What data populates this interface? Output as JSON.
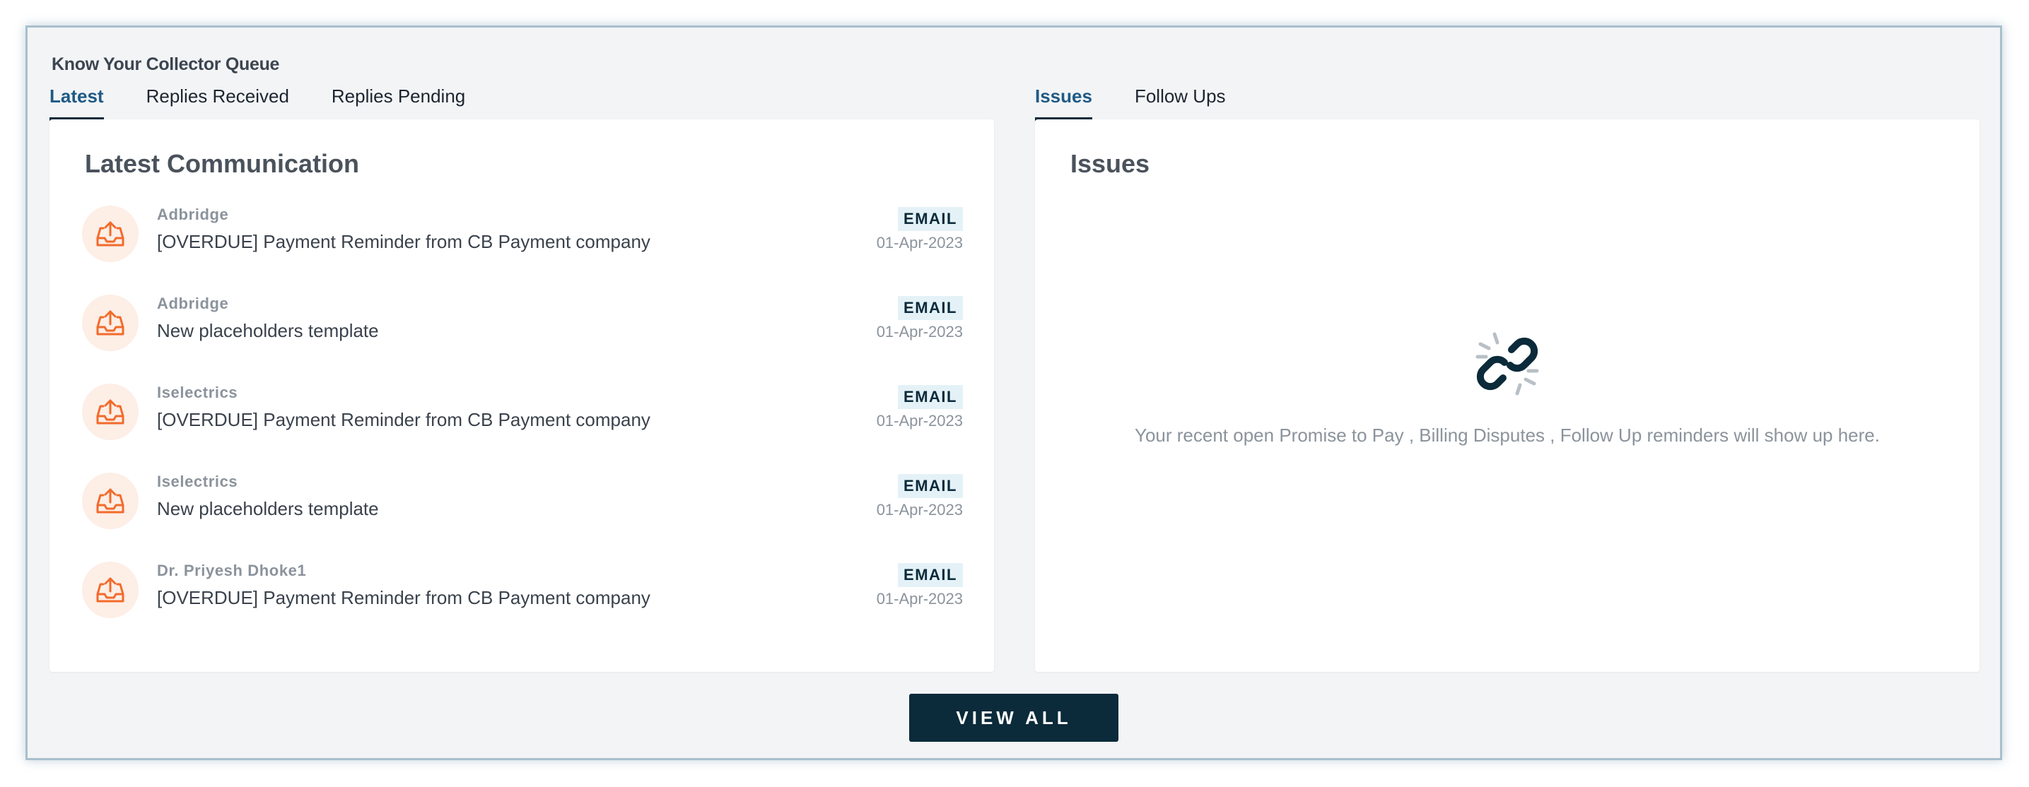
{
  "queue": {
    "title": "Know Your Collector Queue"
  },
  "left_tabs": [
    "Latest",
    "Replies Received",
    "Replies Pending"
  ],
  "right_tabs": [
    "Issues",
    "Follow Ups"
  ],
  "latest_card": {
    "title": "Latest Communication",
    "items": [
      {
        "sender": "Adbridge",
        "subject": "[OVERDUE] Payment Reminder from CB Payment company",
        "channel": "EMAIL",
        "date": "01-Apr-2023",
        "icon": "outbox-upload-icon"
      },
      {
        "sender": "Adbridge",
        "subject": "New placeholders template",
        "channel": "EMAIL",
        "date": "01-Apr-2023",
        "icon": "outbox-upload-icon"
      },
      {
        "sender": "Iselectrics",
        "subject": "[OVERDUE] Payment Reminder from CB Payment company",
        "channel": "EMAIL",
        "date": "01-Apr-2023",
        "icon": "outbox-upload-icon"
      },
      {
        "sender": "Iselectrics",
        "subject": "New placeholders template",
        "channel": "EMAIL",
        "date": "01-Apr-2023",
        "icon": "outbox-upload-icon"
      },
      {
        "sender": "Dr. Priyesh Dhoke1",
        "subject": "[OVERDUE] Payment Reminder from CB Payment company",
        "channel": "EMAIL",
        "date": "01-Apr-2023",
        "icon": "outbox-upload-icon"
      }
    ]
  },
  "issues_card": {
    "title": "Issues",
    "empty_icon": "broken-link-icon",
    "empty_text": "Your recent open Promise to Pay , Billing Disputes , Follow Up reminders will show up here."
  },
  "actions": {
    "view_all_label": "VIEW ALL"
  },
  "colors": {
    "primary": "#0b2a3a",
    "active_tab_text": "#1f5a85",
    "icon_accent": "#f26b2a",
    "icon_bg": "#fdeee6",
    "badge_bg": "#e4f2f8",
    "muted_text": "#8b939c",
    "page_bg": "#f3f4f6"
  }
}
